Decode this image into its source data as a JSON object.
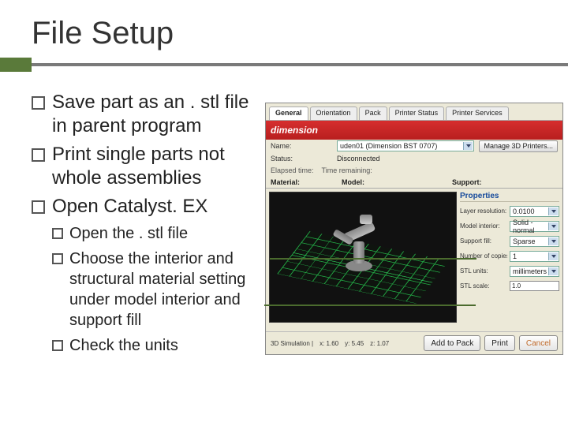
{
  "slide": {
    "title": "File Setup",
    "bullets": [
      "Save part as an . stl file in parent program",
      "Print single parts not whole assemblies",
      "Open Catalyst. EX"
    ],
    "sub_bullets": [
      "Open the . stl file",
      "Choose the interior and structural material setting under model interior and support fill",
      "Check the units"
    ]
  },
  "app": {
    "tabs": [
      "General",
      "Orientation",
      "Pack",
      "Printer Status",
      "Printer Services"
    ],
    "logo_text": "dimension",
    "info": {
      "name_label": "Name:",
      "name_value": "uden01 (Dimension BST 0707)",
      "manage_btn": "Manage 3D Printers...",
      "status_label": "Status:",
      "status_value": "Disconnected",
      "elapsed_label": "Elapsed time:",
      "remaining_label": "Time remaining:"
    },
    "cols": {
      "c1": "Material:",
      "c2": "Model:",
      "c3": "Support:"
    },
    "properties_title": "Properties",
    "properties": [
      {
        "label": "Layer resolution:",
        "value": "0.0100",
        "kind": "dd"
      },
      {
        "label": "Model interior:",
        "value": "Solid - normal",
        "kind": "dd"
      },
      {
        "label": "Support fill:",
        "value": "Sparse",
        "kind": "dd"
      },
      {
        "label": "Number of copies:",
        "value": "1",
        "kind": "dd"
      },
      {
        "label": "STL units:",
        "value": "millimeters",
        "kind": "dd"
      },
      {
        "label": "STL scale:",
        "value": "1.0",
        "kind": "text"
      }
    ],
    "footer": {
      "sim_label": "3D Simulation |",
      "sim_x": "x: 1.60",
      "sim_y": "y: 5.45",
      "sim_z": "z: 1.07",
      "add_btn": "Add to Pack",
      "print_btn": "Print",
      "cancel_btn": "Cancel"
    }
  }
}
